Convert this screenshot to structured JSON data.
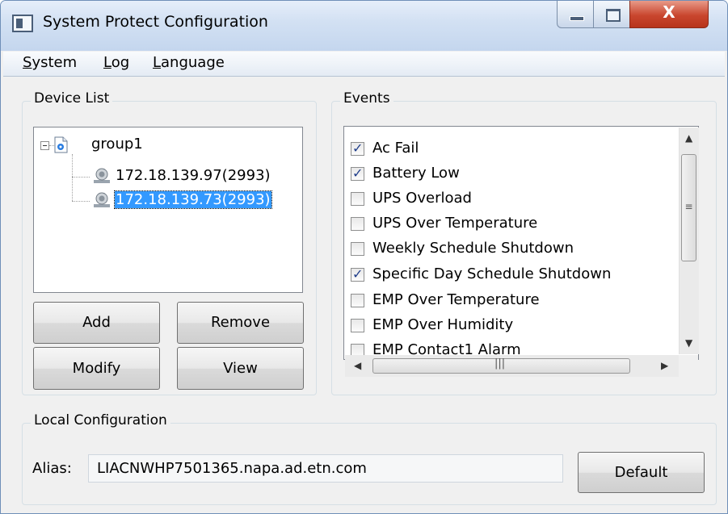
{
  "window": {
    "title": "System Protect Configuration"
  },
  "menu": [
    {
      "label": "System",
      "accel": "S",
      "rest": "ystem"
    },
    {
      "label": "Log",
      "accel": "L",
      "rest": "og"
    },
    {
      "label": "Language",
      "accel": "L",
      "rest": "anguage"
    }
  ],
  "device_list": {
    "title": "Device List",
    "group": "group1",
    "devices": [
      "172.18.139.97(2993)",
      "172.18.139.73(2993)"
    ],
    "selected_index": 1,
    "buttons": {
      "add": "Add",
      "remove": "Remove",
      "modify": "Modify",
      "view": "View"
    }
  },
  "events": {
    "title": "Events",
    "items": [
      {
        "label": "Ac Fail",
        "checked": true
      },
      {
        "label": "Battery Low",
        "checked": true
      },
      {
        "label": "UPS Overload",
        "checked": false
      },
      {
        "label": "UPS Over Temperature",
        "checked": false
      },
      {
        "label": "Weekly Schedule Shutdown",
        "checked": false
      },
      {
        "label": "Specific Day Schedule Shutdown",
        "checked": true
      },
      {
        "label": "EMP Over Temperature",
        "checked": false
      },
      {
        "label": "EMP Over Humidity",
        "checked": false
      },
      {
        "label": "EMP Contact1 Alarm",
        "checked": false
      }
    ]
  },
  "local_config": {
    "title": "Local Configuration",
    "alias_label": "Alias:",
    "alias_value": "LIACNWHP7501365.napa.ad.etn.com",
    "default_button": "Default"
  },
  "icons": {
    "app": "window-app-icon",
    "group": "group-config-icon",
    "device": "ups-device-icon",
    "minimize": "minimize-icon",
    "maximize": "maximize-icon",
    "close": "close-icon"
  },
  "colors": {
    "selection": "#3399ff",
    "close_button": "#c9462e"
  }
}
